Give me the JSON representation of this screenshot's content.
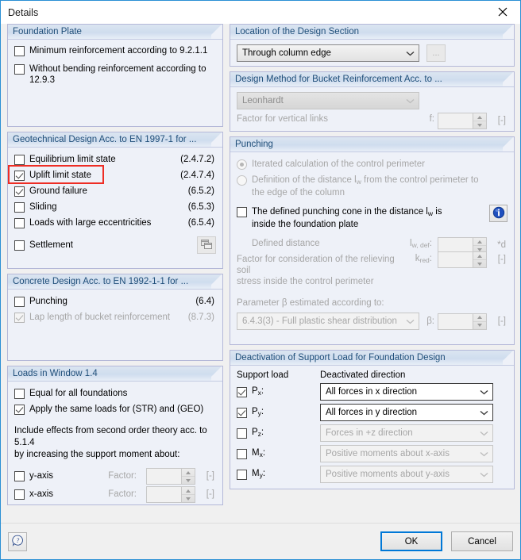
{
  "window": {
    "title": "Details",
    "close_icon": "close-icon"
  },
  "left": {
    "foundation_plate": {
      "header": "Foundation Plate",
      "items": [
        {
          "label": "Minimum reinforcement according to 9.2.1.1",
          "checked": false
        },
        {
          "label": "Without bending reinforcement according to 12.9.3",
          "checked": false
        }
      ]
    },
    "geotechnical": {
      "header": "Geotechnical Design Acc. to EN 1997-1 for ...",
      "items": [
        {
          "label": "Equilibrium limit state",
          "code": "(2.4.7.2)",
          "checked": false
        },
        {
          "label": "Uplift limit state",
          "code": "(2.4.7.4)",
          "checked": true
        },
        {
          "label": "Ground failure",
          "code": "(6.5.2)",
          "checked": true
        },
        {
          "label": "Sliding",
          "code": "(6.5.3)",
          "checked": false
        },
        {
          "label": "Loads with large eccentricities",
          "code": "(6.5.4)",
          "checked": false
        }
      ],
      "settlement": {
        "label": "Settlement",
        "checked": false,
        "button_icon": "settings-window-icon"
      }
    },
    "concrete": {
      "header": "Concrete Design Acc. to EN 1992-1-1 for ...",
      "items": [
        {
          "label": "Punching",
          "code": "(6.4)",
          "checked": false,
          "disabled": false
        },
        {
          "label": "Lap length of bucket reinforcement",
          "code": "(8.7.3)",
          "checked": true,
          "disabled": true
        }
      ]
    },
    "loads": {
      "header": "Loads in Window 1.4",
      "items": [
        {
          "label": "Equal for all foundations",
          "checked": false
        },
        {
          "label": "Apply the same loads for (STR) and (GEO)",
          "checked": true
        }
      ],
      "note_line1": "Include effects from second order theory acc. to 5.1.4",
      "note_line2": "by increasing the support moment about:",
      "axes": [
        {
          "label": "y-axis",
          "checked": false,
          "factor_label": "Factor:",
          "factor_value": "",
          "unit": "[-]"
        },
        {
          "label": "x-axis",
          "checked": false,
          "factor_label": "Factor:",
          "factor_value": "",
          "unit": "[-]"
        }
      ]
    }
  },
  "right": {
    "location": {
      "header": "Location of the Design Section",
      "selected": "Through column edge",
      "browse_label": "...",
      "chevron_icon": "chevron-down-icon"
    },
    "design_method": {
      "header": "Design Method for Bucket Reinforcement Acc. to ...",
      "selected": "Leonhardt",
      "factor_label": "Factor for vertical links",
      "factor_symbol": "f:",
      "factor_value": "",
      "unit": "[-]"
    },
    "punching": {
      "header": "Punching",
      "radios": [
        {
          "label": "Iterated calculation of the control perimeter",
          "selected": true
        },
        {
          "label_pre": "Definition of the distance l",
          "label_sub": "w",
          "label_post": " from the control perimeter to",
          "label_line2": "the edge of the column",
          "selected": false
        }
      ],
      "cone_check": {
        "line1_pre": "The defined punching cone in the distance l",
        "line1_sub": "w",
        "line1_post": " is",
        "line2": "inside the foundation plate",
        "checked": false,
        "info_icon": "info-icon"
      },
      "defined_distance": {
        "label": "Defined distance",
        "symbol_pre": "l",
        "symbol_sub": "w, def",
        "symbol_post": ":",
        "value": "",
        "unit": "*d"
      },
      "k_red": {
        "label_line1": "Factor for consideration of the relieving soil",
        "label_line2": "stress inside the control perimeter",
        "symbol_pre": "k",
        "symbol_sub": "red",
        "symbol_post": ":",
        "value": "",
        "unit": "[-]"
      },
      "beta": {
        "label_pre": "Parameter ",
        "label_symbol": "β",
        "label_post": " estimated according to:",
        "selected": "6.4.3(3) - Full plastic shear distribution",
        "symbol": "β:",
        "value": "",
        "unit": "[-]"
      }
    },
    "deactivation": {
      "header": "Deactivation of Support Load for Foundation Design",
      "col1_header": "Support load",
      "col2_header": "Deactivated direction",
      "rows": [
        {
          "sym_pre": "P",
          "sym_sub": "x",
          "sym_post": ":",
          "checked": true,
          "direction": "All forces in x direction",
          "bold_token": "x",
          "disabled": false
        },
        {
          "sym_pre": "P",
          "sym_sub": "y",
          "sym_post": ":",
          "checked": true,
          "direction": "All forces in y direction",
          "bold_token": "y",
          "disabled": false
        },
        {
          "sym_pre": "P",
          "sym_sub": "z",
          "sym_post": ":",
          "checked": false,
          "direction": "Forces in +z direction",
          "bold_token": "+z",
          "disabled": true
        },
        {
          "sym_pre": "M",
          "sym_sub": "x",
          "sym_post": ":",
          "checked": false,
          "direction": "Positive moments about x-axis",
          "bold_token": "",
          "disabled": true
        },
        {
          "sym_pre": "M",
          "sym_sub": "y",
          "sym_post": ":",
          "checked": false,
          "direction": "Positive moments about y-axis",
          "bold_token": "",
          "disabled": true
        }
      ]
    }
  },
  "footer": {
    "help_icon": "help-icon",
    "ok_label": "OK",
    "cancel_label": "Cancel"
  },
  "colors": {
    "accent": "#0078d7",
    "highlight": "#ee2d24",
    "group_header_text": "#1f4e79",
    "group_bg": "#eef1f8",
    "disabled_text": "#a6a6a6"
  }
}
